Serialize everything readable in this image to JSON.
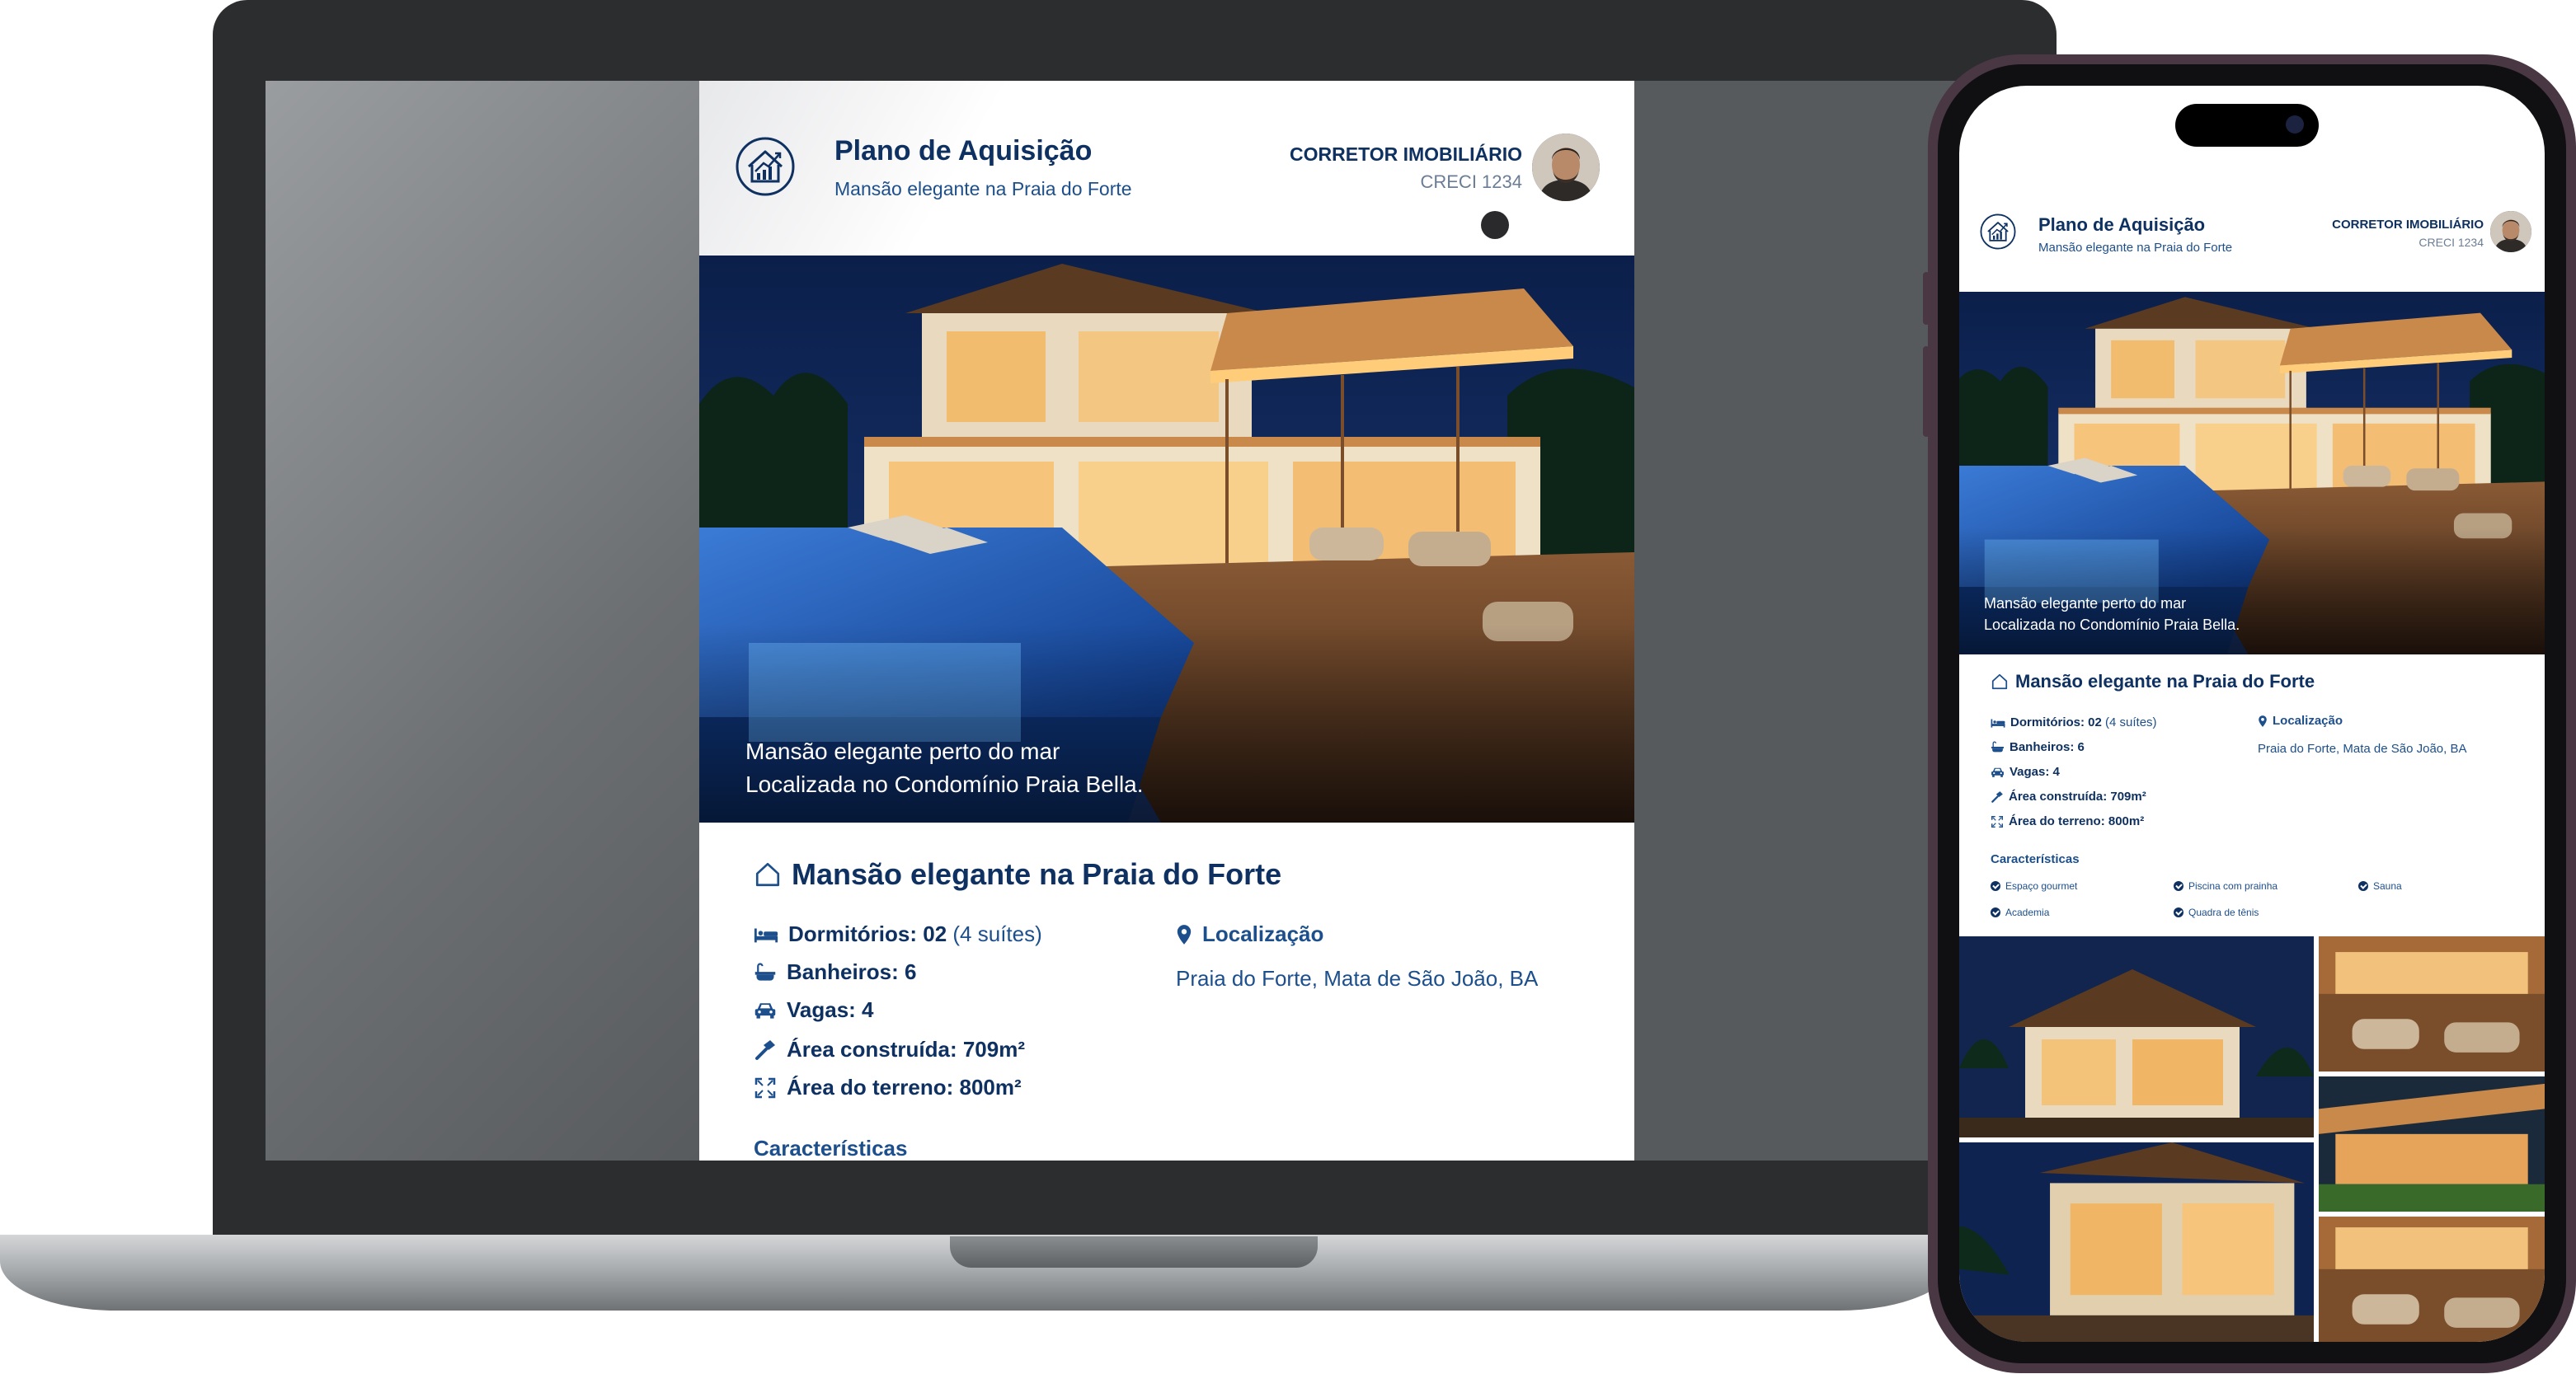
{
  "listing": {
    "header_title": "Plano de Aquisição",
    "header_subtitle": "Mansão elegante na Praia do Forte",
    "broker_label": "CORRETOR IMOBILIÁRIO",
    "broker_creci": "CRECI 1234",
    "photo_caption_line1": "Mansão elegante perto do mar",
    "photo_caption_line2": "Localizada no Condomínio Praia Bella.",
    "section_title": "Mansão elegante na Praia do Forte",
    "specs": {
      "bedrooms_label": "Dormitórios:",
      "bedrooms_value": "02",
      "bedrooms_note": "(4 suítes)",
      "bathrooms": "Banheiros: 6",
      "parking": "Vagas: 4",
      "built_area": "Área construída: 709m²",
      "land_area": "Área do terreno: 800m²"
    },
    "location_title": "Localização",
    "location_value": "Praia do Forte, Mata de São João, BA",
    "features_title": "Características",
    "features": [
      "Espaço gourmet",
      "Piscina com prainha",
      "Sauna",
      "Academia",
      "Quadra de tênis"
    ]
  },
  "colors": {
    "navy": "#0e3161",
    "blue": "#1c4f8c",
    "laptop_body": "#2c2d2f",
    "phone_frame": "#4a3744"
  },
  "icons": {
    "logo": "house-chart-icon",
    "title": "house-outline-icon",
    "bedrooms": "bed-icon",
    "bathrooms": "bathtub-icon",
    "parking": "car-icon",
    "built_area": "hammer-icon",
    "land_area": "expand-icon",
    "location": "map-pin-icon",
    "feature": "check-circle-icon"
  }
}
